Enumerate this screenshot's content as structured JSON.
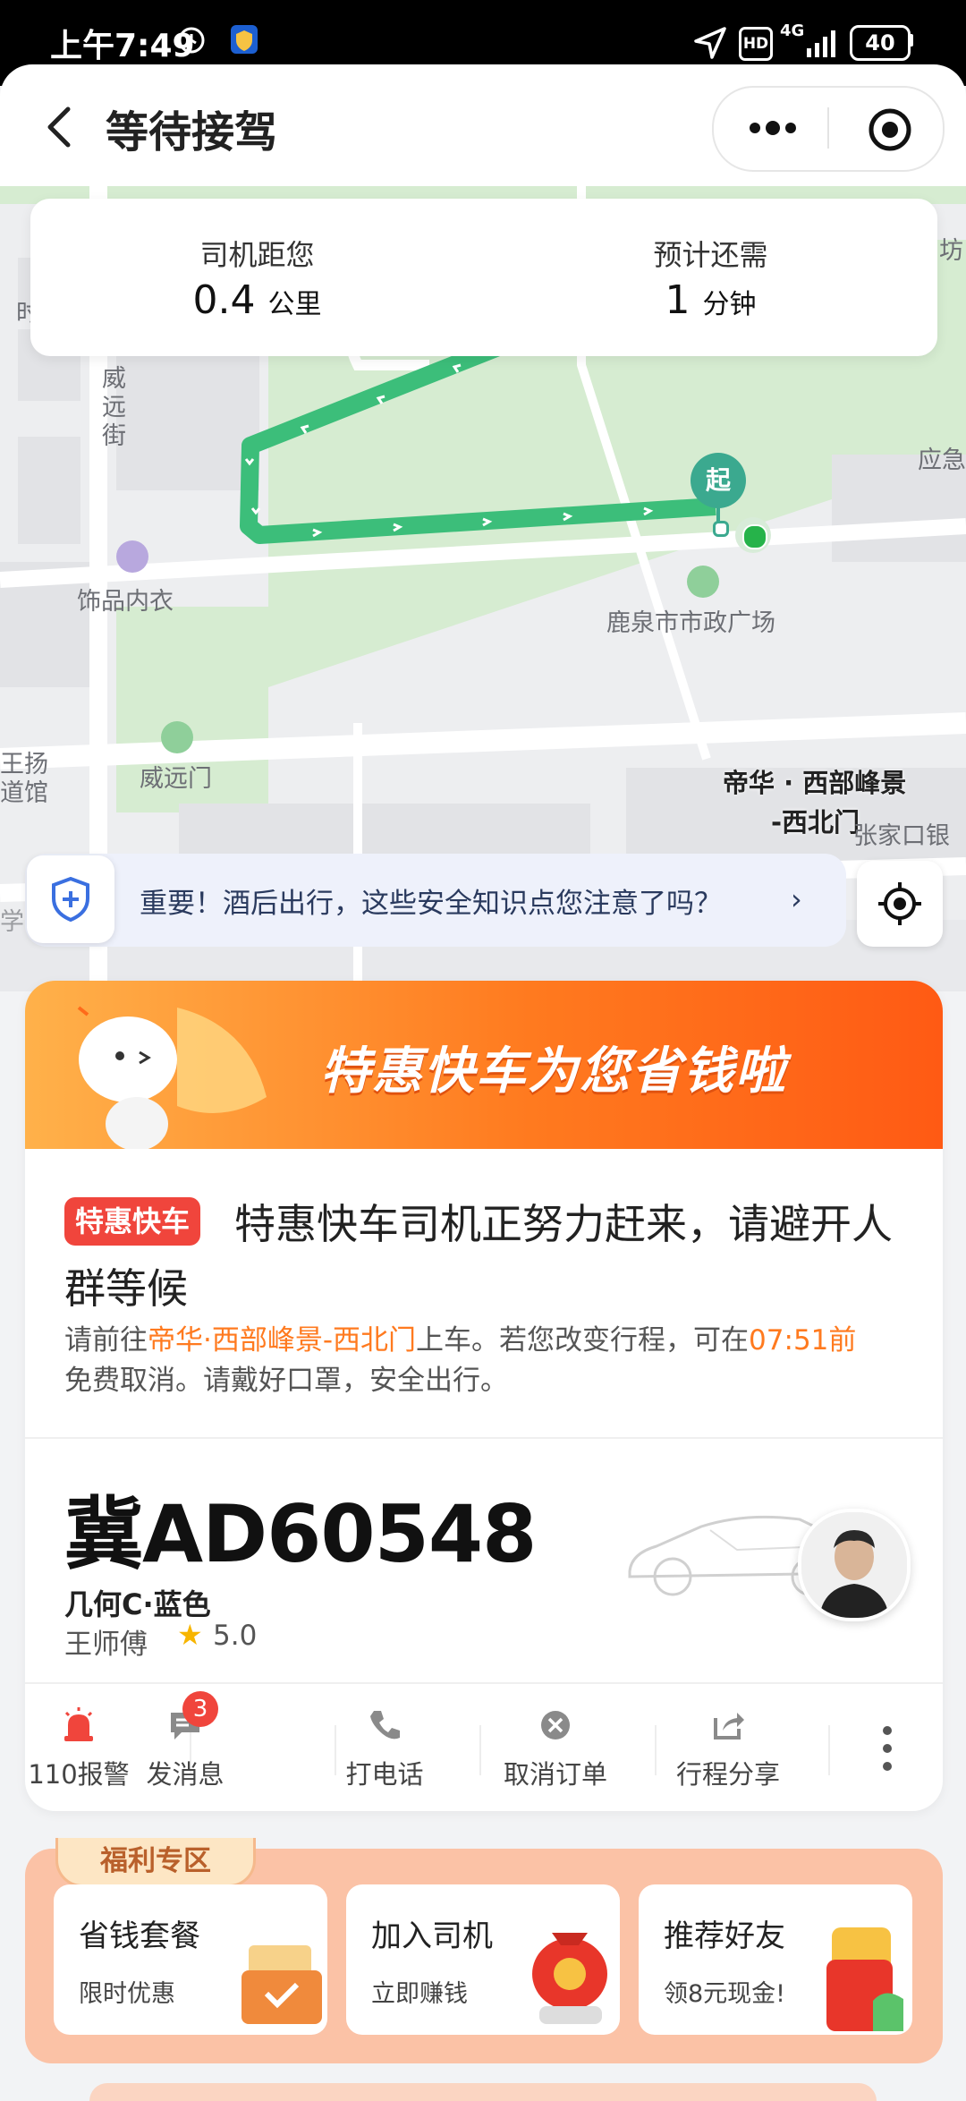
{
  "status_bar": {
    "time": "上午7:49",
    "network": "4G",
    "battery": "40"
  },
  "header": {
    "title": "等待接驾"
  },
  "eta": {
    "distance_label": "司机距您",
    "distance_value": "0.4",
    "distance_unit": "公里",
    "time_label": "预计还需",
    "time_value": "1",
    "time_unit": "分钟"
  },
  "map": {
    "labels": {
      "weiyuan_street": "威远街",
      "accessory_store": "饰品内衣",
      "weiyuan_gate": "威远门",
      "civic_plaza": "鹿泉市市政广场",
      "pickup_name_line1": "帝华 · 西部峰景",
      "pickup_name_line2": "-西北门",
      "emergency": "应急",
      "bank": "张家口银",
      "stadium_line1": "王扬",
      "stadium_line2": "道馆",
      "fang": "坊",
      "shi": "时",
      "xue": "学"
    },
    "start_marker": "起"
  },
  "safety": {
    "text": "重要！酒后出行，这些安全知识点您注意了吗？",
    "arrow": "›"
  },
  "banner": {
    "text": "特惠快车为您省钱啦"
  },
  "order": {
    "tag": "特惠快车",
    "headline": "特惠快车司机正努力赶来，请避开人群等候",
    "desc_prefix": "请前往",
    "pickup": "帝华·西部峰景-西北门",
    "desc_mid": "上车。若您改变行程，可在",
    "deadline": "07:51前",
    "desc_suffix": "免费取消。请戴好口罩，安全出行。"
  },
  "driver": {
    "plate": "冀AD60548",
    "car_model": "几何C·蓝色",
    "name": "王师傅",
    "rating": "5.0"
  },
  "actions": {
    "police": "110报警",
    "message": "发消息",
    "message_badge": "3",
    "call": "打电话",
    "cancel": "取消订单",
    "share": "行程分享"
  },
  "welfare": {
    "title": "福利专区",
    "cards": [
      {
        "title": "省钱套餐",
        "subtitle": "限时优惠"
      },
      {
        "title": "加入司机",
        "subtitle": "立即赚钱"
      },
      {
        "title": "推荐好友",
        "subtitle": "领8元现金!"
      }
    ]
  },
  "colors": {
    "route": "#3cbe7a",
    "accent_orange": "#ff7a1f",
    "tag_red": "#f0453c",
    "safety_blue": "#3a6fe0"
  }
}
